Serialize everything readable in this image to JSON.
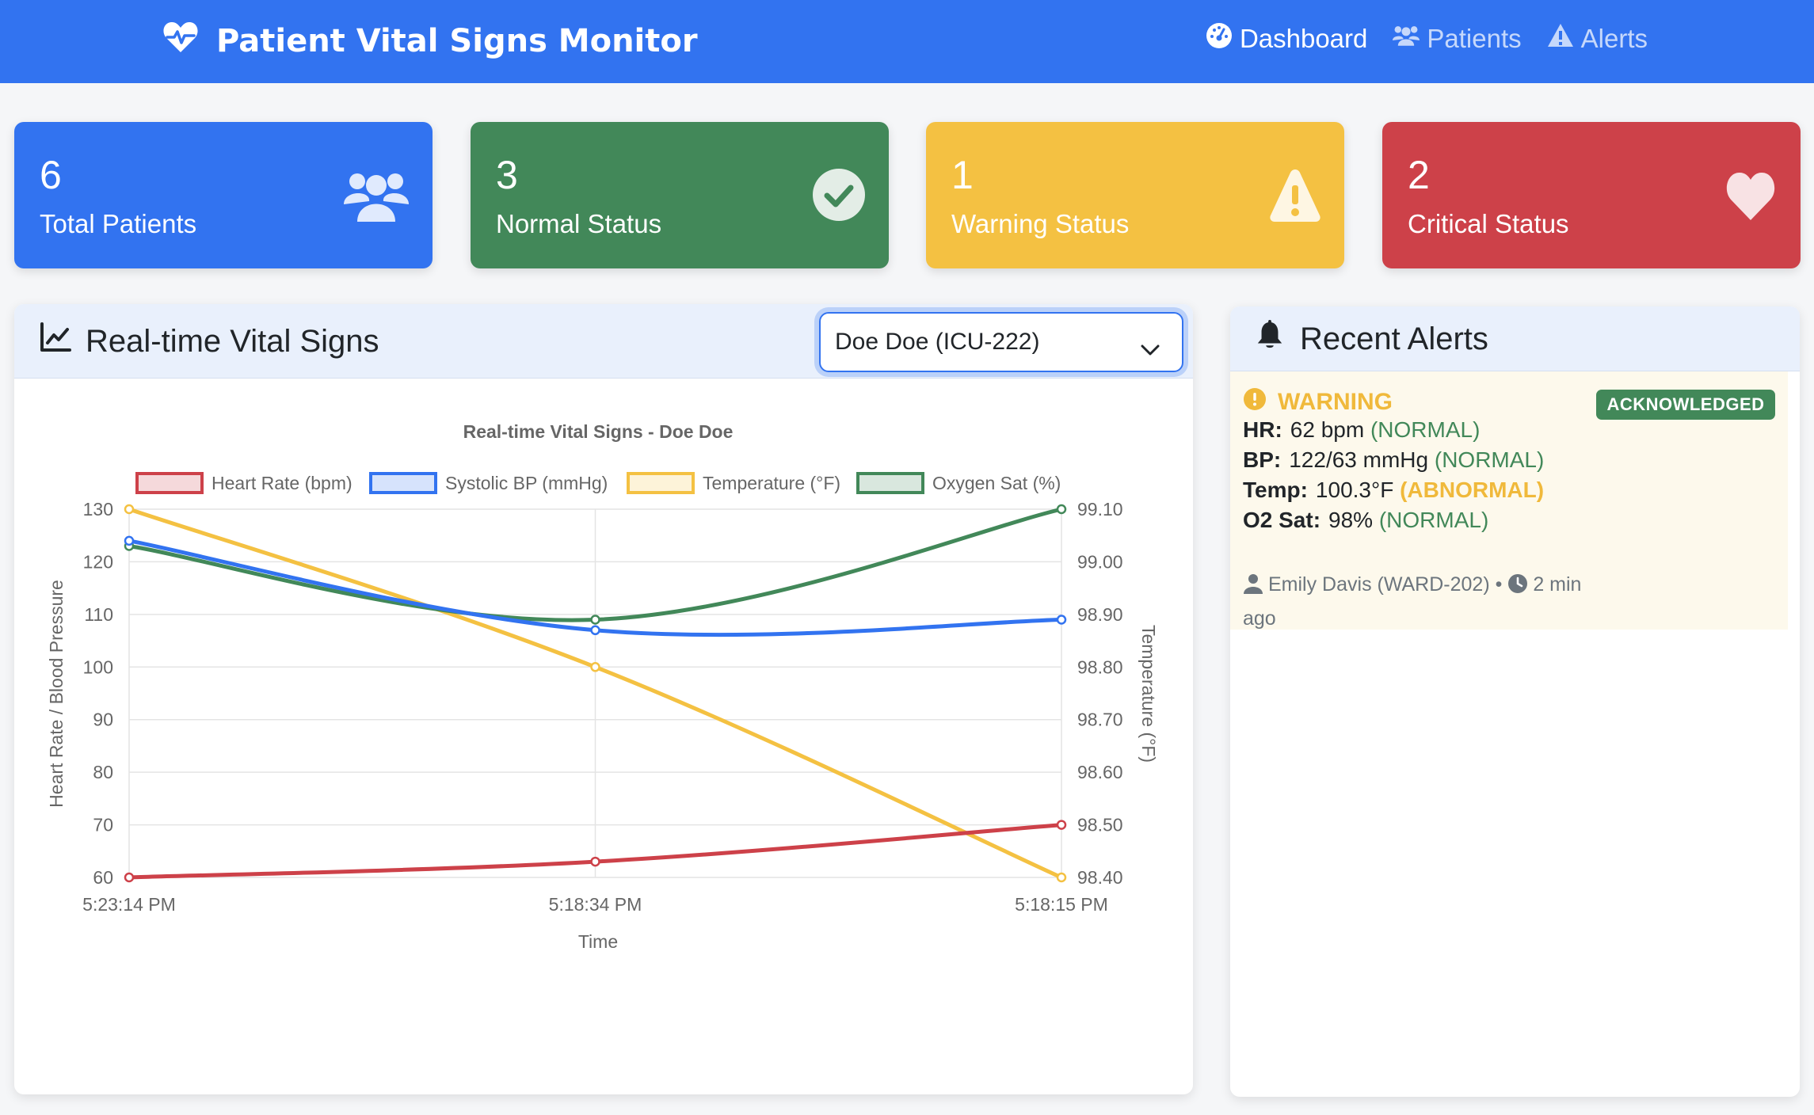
{
  "navbar": {
    "brand": "Patient Vital Signs Monitor",
    "brand_icon": "heart-pulse-icon",
    "links": [
      {
        "label": "Dashboard",
        "icon": "gauge-icon",
        "active": true
      },
      {
        "label": "Patients",
        "icon": "users-icon",
        "active": false
      },
      {
        "label": "Alerts",
        "icon": "warning-icon",
        "active": false
      }
    ]
  },
  "stats": {
    "total": {
      "value": "6",
      "label": "Total Patients",
      "icon": "users-icon"
    },
    "normal": {
      "value": "3",
      "label": "Normal Status",
      "icon": "check-circle-icon"
    },
    "warning": {
      "value": "1",
      "label": "Warning Status",
      "icon": "warning-icon"
    },
    "critical": {
      "value": "2",
      "label": "Critical Status",
      "icon": "heart-icon"
    }
  },
  "vitals_panel": {
    "title": "Real-time Vital Signs",
    "title_icon": "chart-line-icon",
    "patient_select": {
      "selected": "Doe Doe (ICU-222)"
    }
  },
  "chart_data": {
    "type": "line",
    "title": "Real-time Vital Signs - Doe Doe",
    "x": [
      "5:23:14 PM",
      "5:18:34 PM",
      "5:18:15 PM"
    ],
    "xlabel": "Time",
    "ylabel_left": "Heart Rate / Blood Pressure",
    "ylabel_right": "Temperature (°F)",
    "ylim_left": [
      60,
      130
    ],
    "yticks_left": [
      "130",
      "120",
      "110",
      "100",
      "90",
      "80",
      "70",
      "60"
    ],
    "ylim_right": [
      98.4,
      99.1
    ],
    "yticks_right": [
      "99.10",
      "99.00",
      "98.90",
      "98.80",
      "98.70",
      "98.60",
      "98.50",
      "98.40"
    ],
    "grid": true,
    "legend_position": "top",
    "series": [
      {
        "name": "Heart Rate (bpm)",
        "axis": "left",
        "color": "#cd4149",
        "values": [
          60,
          63,
          70
        ]
      },
      {
        "name": "Systolic BP (mmHg)",
        "axis": "left",
        "color": "#3273f0",
        "values": [
          124,
          107,
          109
        ]
      },
      {
        "name": "Temperature (°F)",
        "axis": "right",
        "color": "#f4c142",
        "values": [
          99.1,
          98.8,
          98.4
        ]
      },
      {
        "name": "Oxygen Sat (%)",
        "axis": "left",
        "color": "#428859",
        "values": [
          123,
          109,
          130
        ]
      }
    ]
  },
  "alerts_panel": {
    "title": "Recent Alerts",
    "title_icon": "bell-icon",
    "items": [
      {
        "level": "WARNING",
        "badge": "ACKNOWLEDGED",
        "hr_label": "HR:",
        "hr_value": "62 bpm",
        "hr_status": "(NORMAL)",
        "bp_label": "BP:",
        "bp_value": "122/63 mmHg",
        "bp_status": "(NORMAL)",
        "temp_label": "Temp:",
        "temp_value": "100.3°F",
        "temp_status": "(ABNORMAL)",
        "o2_label": "O2 Sat:",
        "o2_value": "98%",
        "o2_status": "(NORMAL)",
        "patient": "Emily Davis (WARD-202)",
        "separator": "•",
        "time": "2 min ago"
      }
    ]
  },
  "colors": {
    "primary": "#3273f0",
    "success": "#428859",
    "warning": "#f4c142",
    "danger": "#cd4149"
  }
}
